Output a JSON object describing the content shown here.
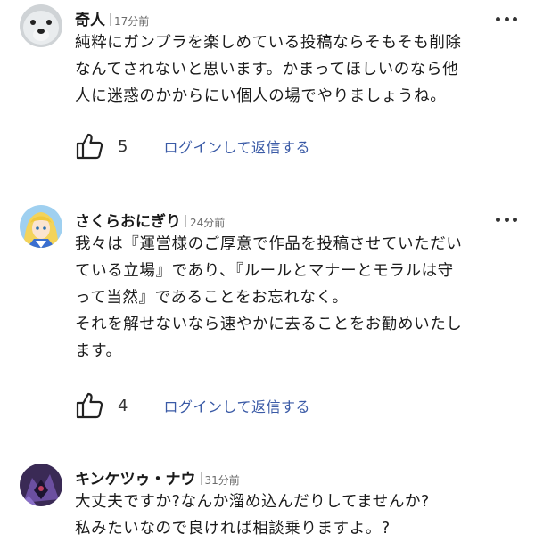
{
  "comments": [
    {
      "author": "奇人",
      "time": "17分前",
      "avatar_icon": "polar-bear-avatar",
      "lines": [
        "純粋にガンプラを楽しめている投稿ならそもそも削除",
        "なんてされないと思います。かまってほしいのなら他",
        "人に迷惑のかからにい個人の場でやりましょうね。"
      ],
      "likes": "5",
      "reply_label": "ログインして返信する"
    },
    {
      "author": "さくらおにぎり",
      "time": "24分前",
      "avatar_icon": "anime-character-avatar",
      "lines": [
        "我々は『運営様のご厚意で作品を投稿させていただい",
        "ている立場』であり、『ルールとマナーとモラルは守",
        "って当然』であることをお忘れなく。",
        "それを解せないなら速やかに去ることをお勧めいたし",
        "ます。"
      ],
      "likes": "4",
      "reply_label": "ログインして返信する"
    },
    {
      "author": "キンケツゥ・ナウ",
      "time": "31分前",
      "avatar_icon": "dark-robot-avatar",
      "lines": [
        "大丈夫ですか?なんか溜め込んだりしてませんか?",
        "私みたいなので良ければ相談乗りますよ。?"
      ]
    }
  ],
  "colors": {
    "text": "#1a1a1a",
    "meta": "#6b6b6b",
    "reply_link": "#3a5aa6",
    "background": "#ffffff"
  }
}
